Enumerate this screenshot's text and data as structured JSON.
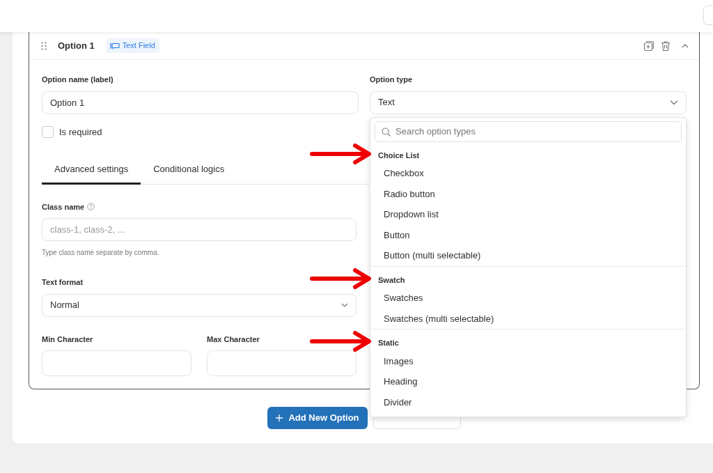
{
  "option": {
    "title": "Option 1",
    "badge": "Text Field",
    "expanded": true
  },
  "name_field": {
    "label": "Option name (label)",
    "value": "Option 1"
  },
  "required": {
    "label": "Is required",
    "checked": false
  },
  "type_field": {
    "label": "Option type",
    "value": "Text",
    "expanded": true
  },
  "tabs": [
    {
      "label": "Advanced settings",
      "selected": true
    },
    {
      "label": "Conditional logics",
      "selected": false
    }
  ],
  "class_name": {
    "label": "Class name",
    "placeholder": "class-1, class-2, ...",
    "help": "Type class name separate by comma."
  },
  "text_format": {
    "label": "Text format",
    "value": "Normal"
  },
  "min_character": {
    "label": "Min Character"
  },
  "max_character": {
    "label": "Max Character"
  },
  "dropdown": {
    "search_placeholder": "Search option types",
    "groups": [
      {
        "title": "Choice List",
        "marked": true,
        "items": [
          "Checkbox",
          "Radio button",
          "Dropdown list",
          "Button",
          "Button (multi selectable)"
        ]
      },
      {
        "title": "Swatch",
        "marked": true,
        "items": [
          "Swatches",
          "Swatches (multi selectable)"
        ]
      },
      {
        "title": "Static",
        "marked": true,
        "items": [
          "Images",
          "Heading",
          "Divider"
        ]
      }
    ]
  },
  "add_button": {
    "label": "Add New Option"
  }
}
